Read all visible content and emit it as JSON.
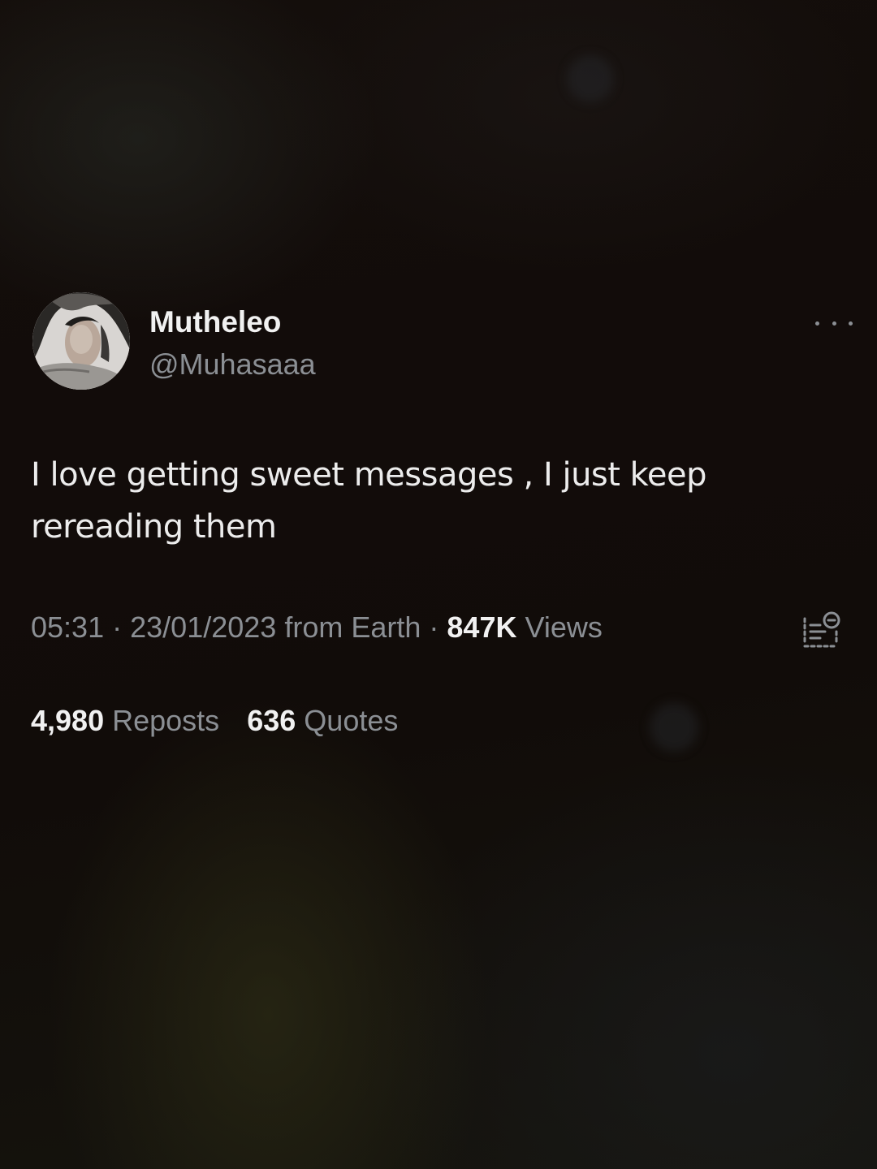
{
  "author": {
    "display_name": "Mutheleo",
    "handle": "@Muhasaaa",
    "avatar_icon": "profile-photo"
  },
  "tweet": {
    "text_line1": "I love getting sweet messages , I just keep",
    "text_line2": "rereading them"
  },
  "meta": {
    "time": "05:31",
    "separator": "·",
    "date": "23/01/2023",
    "source": "from Earth",
    "views_count": "847K",
    "views_label": "Views"
  },
  "engagement": {
    "reposts_count": "4,980",
    "reposts_label": "Reposts",
    "quotes_count": "636",
    "quotes_label": "Quotes"
  },
  "icons": {
    "more": "more-horizontal-icon",
    "analytics": "analytics-icon"
  },
  "colors": {
    "background": "#120c0a",
    "primary_text": "#e7e9ea",
    "secondary_text": "#8b8f94"
  }
}
